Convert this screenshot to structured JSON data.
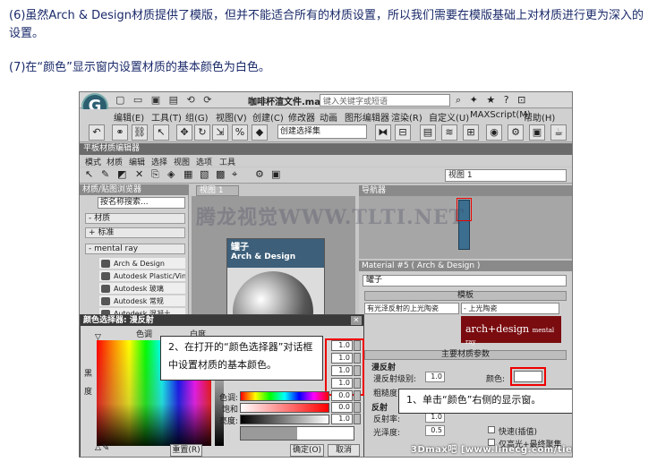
{
  "article": {
    "para1": "(6)虽然Arch & Design材质提供了模版，但并不能适合所有的材质设置，所以我们需要在模版基础上对材质进行更为深入的设置。",
    "para2": "(7)在“颜色”显示窗内设置材质的基本颜色为白色。"
  },
  "app": {
    "logo": "G",
    "file_title": "咖啡杯渲文件.max",
    "search_placeholder": "键入关键字或短语",
    "menu": [
      "编辑(E)",
      "工具(T)",
      "组(G)",
      "视图(V)",
      "创建(C)",
      "修改器",
      "动画",
      "图形编辑器",
      "渲染(R)",
      "自定义(U)",
      "MAXScript(M)",
      "帮助(H)"
    ],
    "selection_set": "创建选择集"
  },
  "material_editor": {
    "title": "平板材质编辑器",
    "menu": [
      "模式",
      "材质",
      "编辑",
      "选择",
      "视图",
      "选项",
      "工具"
    ],
    "view_dropdown": "视图 1",
    "browser_header": "材质/贴图浏览器",
    "browser_search": "按名称搜索...",
    "groups": [
      "- 材质",
      "+ 标准",
      "- mental ray"
    ],
    "materials": [
      "Arch & Design",
      "Autodesk Plastic/Vinyl",
      "Autodesk 玻璃",
      "Autodesk 常规",
      "Autodesk 混凝土"
    ],
    "view_tab": "视图 1",
    "node_title": "罐子",
    "node_subtitle": "Arch & Design",
    "navigator_header": "导航器",
    "props_header": "Material #5  ( Arch & Design )",
    "props_name": "罐子",
    "templates_rollout": "模板",
    "template_dd1": "有光泽反射的上光陶瓷",
    "template_dd2": "- 上光陶瓷",
    "logo_main": "arch+design",
    "logo_sub": "mental ray",
    "main_params_rollout": "主要材质参数",
    "diffuse_section": "漫反射",
    "diffuse_level_label": "漫反射级别:",
    "diffuse_level": "1.0",
    "color_label": "颜色:",
    "roughness_label": "粗糙度:",
    "reflection_section": "反射",
    "reflectivity_label": "反射率:",
    "reflectivity": "1.0",
    "glossiness_label": "光泽度:",
    "glossiness": "0.5",
    "fast_interp_label": "快速(插值)",
    "highlight_fg_label": "仅高光+最终聚集"
  },
  "color_selector": {
    "title": "颜色选择器: 漫反射",
    "hue_label": "色调",
    "white_label": "白度",
    "black_label": "黑",
    "degree_label": "度",
    "saturation_label": "色调:",
    "sat_label": "饱和度:",
    "value_label": "亮度:",
    "rgb_values": [
      "1.0",
      "1.0",
      "1.0",
      "1.0"
    ],
    "hsv_values": [
      "0.0",
      "0.0",
      "1.0"
    ],
    "reset_button": "重置(R)",
    "ok_button": "确定(O)",
    "cancel_button": "取消"
  },
  "callouts": {
    "step2": "2、在打开的“颜色选择器”对话框中设置材质的基本颜色。",
    "step1": "1、单击“颜色”右侧的显示窗。"
  },
  "watermarks": {
    "center": "腾龙视觉WWW.TLTI.NET",
    "footer": "3Dmax吧 [www.linecg.com/tieba/1771]"
  }
}
